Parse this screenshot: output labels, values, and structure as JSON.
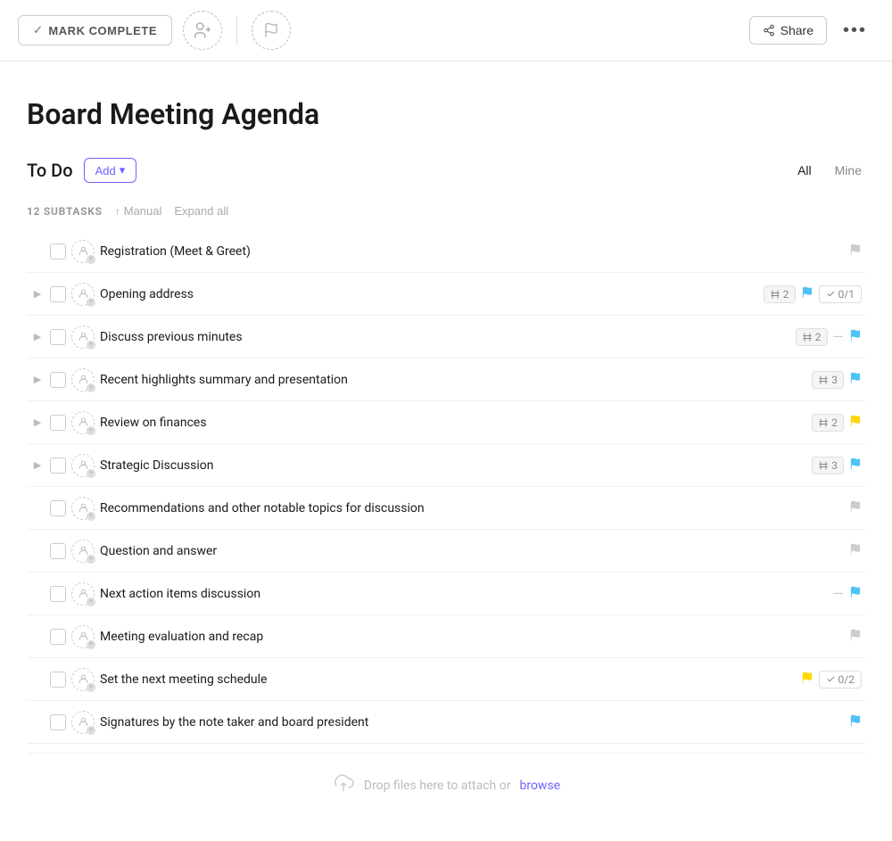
{
  "toolbar": {
    "mark_complete_label": "MARK COMPLETE",
    "share_label": "Share",
    "more_icon": "•••"
  },
  "page": {
    "title": "Board Meeting Agenda"
  },
  "section": {
    "title": "To Do",
    "add_label": "Add",
    "filter_all": "All",
    "filter_mine": "Mine"
  },
  "subtasks": {
    "count_label": "12 SUBTASKS",
    "sort_label": "Manual",
    "expand_label": "Expand all"
  },
  "tasks": [
    {
      "id": 1,
      "name": "Registration (Meet & Greet)",
      "has_expand": false,
      "subtask_count": null,
      "flag": "gray",
      "has_dash": false,
      "has_subtask_badge": false,
      "subtask_badge_text": ""
    },
    {
      "id": 2,
      "name": "Opening address",
      "has_expand": true,
      "subtask_count": 2,
      "flag": "blue",
      "has_dash": false,
      "has_subtask_badge": true,
      "subtask_badge_text": "0/1"
    },
    {
      "id": 3,
      "name": "Discuss previous minutes",
      "has_expand": true,
      "subtask_count": 2,
      "flag": "blue",
      "has_dash": true,
      "has_subtask_badge": false,
      "subtask_badge_text": ""
    },
    {
      "id": 4,
      "name": "Recent highlights summary and presentation",
      "has_expand": true,
      "subtask_count": 3,
      "flag": "blue",
      "has_dash": false,
      "has_subtask_badge": false,
      "subtask_badge_text": ""
    },
    {
      "id": 5,
      "name": "Review on finances",
      "has_expand": true,
      "subtask_count": 2,
      "flag": "yellow",
      "has_dash": false,
      "has_subtask_badge": false,
      "subtask_badge_text": ""
    },
    {
      "id": 6,
      "name": "Strategic Discussion",
      "has_expand": true,
      "subtask_count": 3,
      "flag": "blue",
      "has_dash": false,
      "has_subtask_badge": false,
      "subtask_badge_text": ""
    },
    {
      "id": 7,
      "name": "Recommendations and other notable topics for discussion",
      "has_expand": false,
      "subtask_count": null,
      "flag": "gray",
      "has_dash": false,
      "has_subtask_badge": false,
      "subtask_badge_text": ""
    },
    {
      "id": 8,
      "name": "Question and answer",
      "has_expand": false,
      "subtask_count": null,
      "flag": "gray",
      "has_dash": false,
      "has_subtask_badge": false,
      "subtask_badge_text": ""
    },
    {
      "id": 9,
      "name": "Next action items discussion",
      "has_expand": false,
      "subtask_count": null,
      "flag": "blue",
      "has_dash": true,
      "has_subtask_badge": false,
      "subtask_badge_text": ""
    },
    {
      "id": 10,
      "name": "Meeting evaluation and recap",
      "has_expand": false,
      "subtask_count": null,
      "flag": "gray",
      "has_dash": false,
      "has_subtask_badge": false,
      "subtask_badge_text": ""
    },
    {
      "id": 11,
      "name": "Set the next meeting schedule",
      "has_expand": false,
      "subtask_count": null,
      "flag": "yellow",
      "has_dash": false,
      "has_subtask_badge": true,
      "subtask_badge_text": "0/2"
    },
    {
      "id": 12,
      "name": "Signatures by the note taker and board president",
      "has_expand": false,
      "subtask_count": null,
      "flag": "blue",
      "has_dash": false,
      "has_subtask_badge": false,
      "subtask_badge_text": ""
    }
  ],
  "drop_zone": {
    "text": "Drop files here to attach or ",
    "browse_label": "browse"
  }
}
